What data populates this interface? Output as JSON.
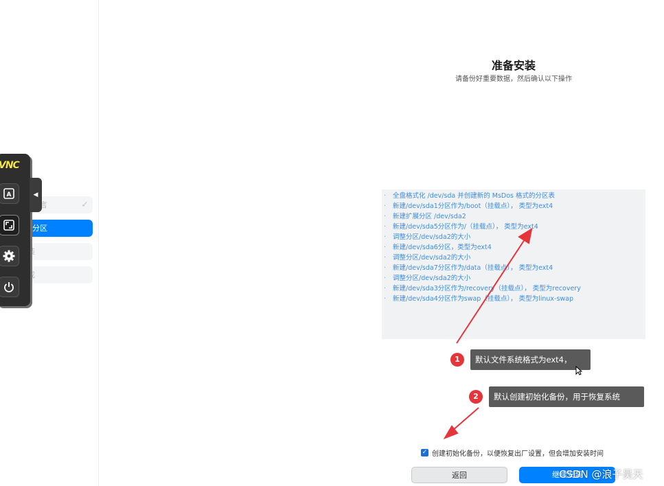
{
  "sidebar": {
    "steps": [
      {
        "label": "言",
        "state": "done"
      },
      {
        "label": "盘分区",
        "state": "active"
      },
      {
        "label": "装",
        "state": "pending"
      },
      {
        "label": "成",
        "state": "pending"
      }
    ]
  },
  "vnc_toolbar": {
    "logo": "VNC",
    "buttons": [
      "keyboard-icon",
      "fullscreen-icon",
      "gear-icon",
      "power-icon"
    ],
    "handle_icon": "chevron-left-icon"
  },
  "main": {
    "title": "准备安装",
    "subtitle": "请备份好重要数据，然后确认以下操作",
    "operations": [
      "全盘格式化 /dev/sda 并创建新的 MsDos 格式的分区表",
      "新建/dev/sda1分区作为/boot（挂载点）， 类型为ext4",
      "新建扩展分区 /dev/sda2",
      "新建/dev/sda5分区作为/（挂载点）， 类型为ext4",
      "调整分区/dev/sda2的大小",
      "新建/dev/sda6分区，类型为ext4",
      "调整分区/dev/sda2的大小",
      "新建/dev/sda7分区作为/data（挂载点）， 类型为ext4",
      "调整分区/dev/sda2的大小",
      "新建/dev/sda3分区作为/recovery（挂载点）， 类型为recovery",
      "新建/dev/sda4分区作为swap（挂载点）， 类型为linux-swap"
    ],
    "backup_checkbox": {
      "label": "创建初始化备份，以便恢复出厂设置，但会增加安装时间",
      "checked": true
    },
    "back_button": "返回",
    "continue_button": "继续安装"
  },
  "annotations": [
    {
      "number": "1",
      "text": "默认文件系统格式为ext4，"
    },
    {
      "number": "2",
      "text": "默认创建初始化备份，用于恢复系统"
    }
  ],
  "watermark": "CSDN @浪子吴天",
  "colors": {
    "accent": "#0081ff",
    "annotation_red": "#e5353a",
    "list_text": "#3c8de1"
  }
}
